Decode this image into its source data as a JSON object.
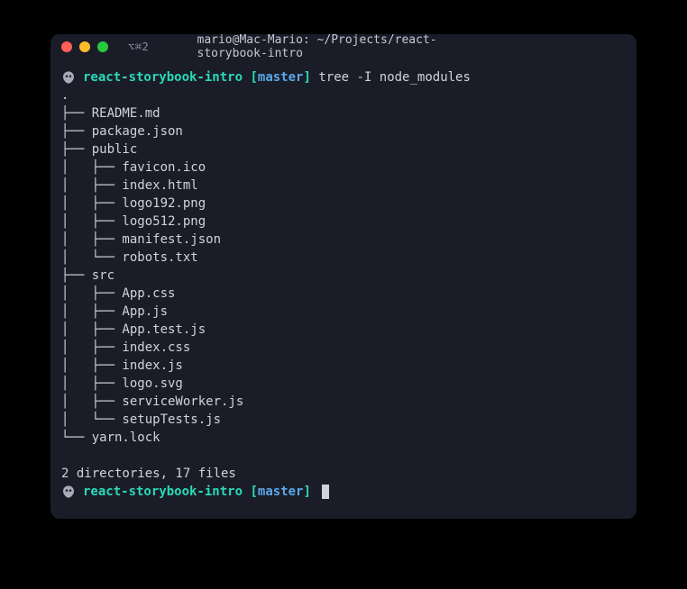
{
  "titlebar": {
    "tab_indicator": "⌥⌘2",
    "title": "mario@Mac-Mario: ~/Projects/react-storybook-intro"
  },
  "prompt1": {
    "dir": "react-storybook-intro",
    "open_bracket": "[",
    "branch": "master",
    "close_bracket": "]",
    "command": "tree -I node_modules"
  },
  "tree_output": ".\n├── README.md\n├── package.json\n├── public\n│   ├── favicon.ico\n│   ├── index.html\n│   ├── logo192.png\n│   ├── logo512.png\n│   ├── manifest.json\n│   └── robots.txt\n├── src\n│   ├── App.css\n│   ├── App.js\n│   ├── App.test.js\n│   ├── index.css\n│   ├── index.js\n│   ├── logo.svg\n│   ├── serviceWorker.js\n│   └── setupTests.js\n└── yarn.lock",
  "summary": "2 directories, 17 files",
  "prompt2": {
    "dir": "react-storybook-intro",
    "open_bracket": "[",
    "branch": "master",
    "close_bracket": "]"
  }
}
